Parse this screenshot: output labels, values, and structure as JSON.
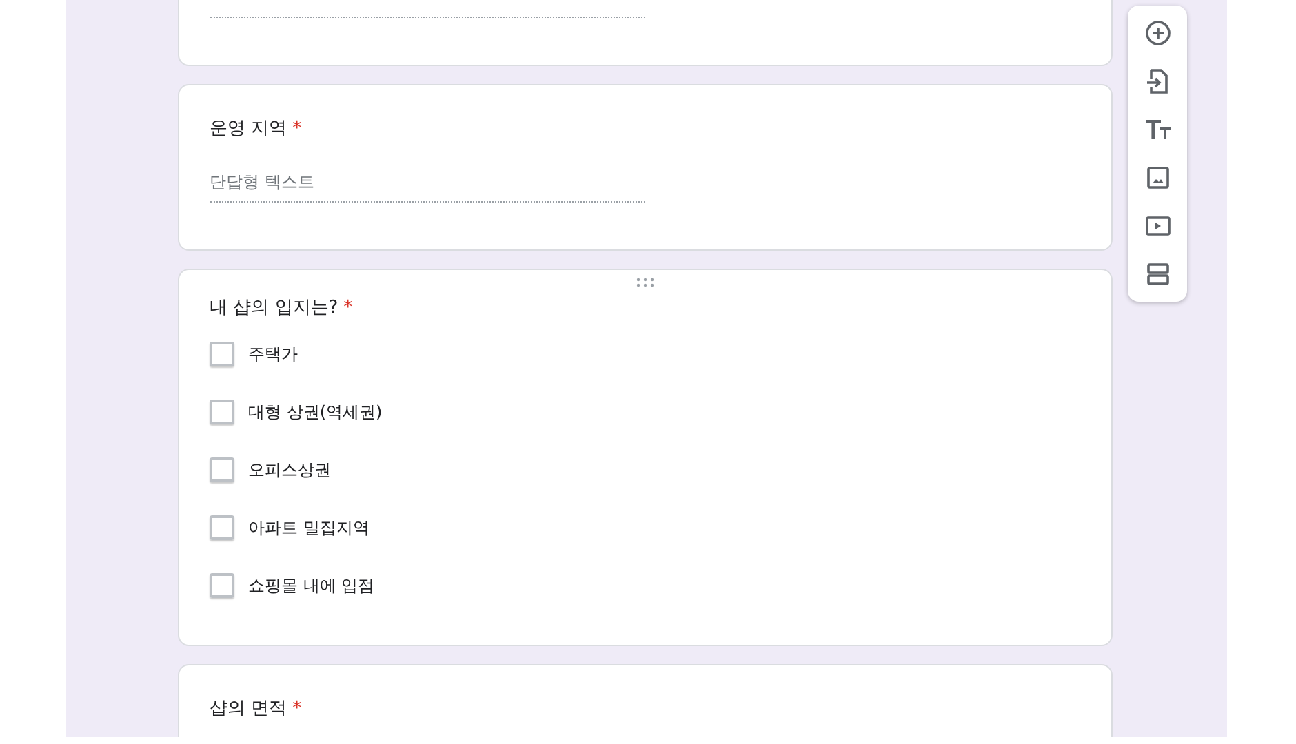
{
  "questions": [
    {
      "kind": "short_answer"
    },
    {
      "kind": "short_answer",
      "title": "운영 지역",
      "required_mark": "*",
      "placeholder": "단답형 텍스트"
    },
    {
      "kind": "checkboxes",
      "title": "내 샵의 입지는?",
      "required_mark": "*",
      "dragging": true,
      "options": [
        {
          "label": "주택가",
          "checked": false
        },
        {
          "label": "대형 상권(역세권)",
          "checked": false
        },
        {
          "label": "오피스상권",
          "checked": false
        },
        {
          "label": "아파트 밀집지역",
          "checked": false
        },
        {
          "label": "쇼핑몰 내에 입점",
          "checked": false
        }
      ]
    },
    {
      "kind": "heading_only",
      "title": "샵의 면적",
      "required_mark": "*"
    }
  ],
  "toolbar": [
    {
      "kind": "add"
    },
    {
      "kind": "import"
    },
    {
      "kind": "title"
    },
    {
      "kind": "image"
    },
    {
      "kind": "video"
    },
    {
      "kind": "section"
    }
  ]
}
